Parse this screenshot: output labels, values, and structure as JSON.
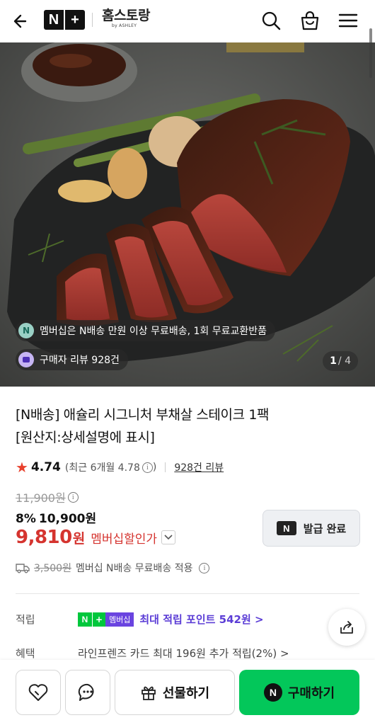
{
  "header": {
    "logo_n": "N",
    "logo_plus": "+",
    "brand_name": "홈스토랑",
    "brand_sub": "by ASHLEY"
  },
  "hero": {
    "membership_notice": "멤버십은 N배송 만원 이상 무료배송, 1회 무료교환반품",
    "buyer_reviews": "구매자 리뷰 928건",
    "image_index": "1",
    "image_total": "/ 4"
  },
  "product": {
    "title_line1": "[N배송] 애슐리 시그니처 부채살 스테이크 1팩",
    "title_line2": "[원산지:상세설명에 표시]",
    "rating": "4.74",
    "recent_rating": "(최근 6개월 4.78",
    "recent_close": ")",
    "review_link": "928건 리뷰",
    "original_price": "11,900원",
    "discount_pct": "8%",
    "discount_price": "10,900원",
    "member_price_num": "9,810",
    "member_price_won": "원",
    "member_price_label": "멤버십할인가",
    "coupon_icon": "N",
    "coupon_label": "발급 완료",
    "ship_fee_original": "3,500원",
    "ship_text": "멤버십 N배송 무료배송 적용"
  },
  "benefits": {
    "points_key": "적립",
    "badge_n": "N",
    "badge_plus": "+",
    "badge_member": "멤버십",
    "points_text": "최대 적립 포인트 542원 >",
    "perk_key": "혜택",
    "perk_text": "라인프렌즈 카드 최대 196원 추가 적립(2%) >"
  },
  "bottom_bar": {
    "gift_label": "선물하기",
    "buy_icon": "N",
    "buy_label": "구매하기"
  },
  "colors": {
    "sale_red": "#d5342f",
    "naver_green": "#03c75a",
    "member_purple": "#5b3dd6",
    "star": "#e8402c"
  }
}
